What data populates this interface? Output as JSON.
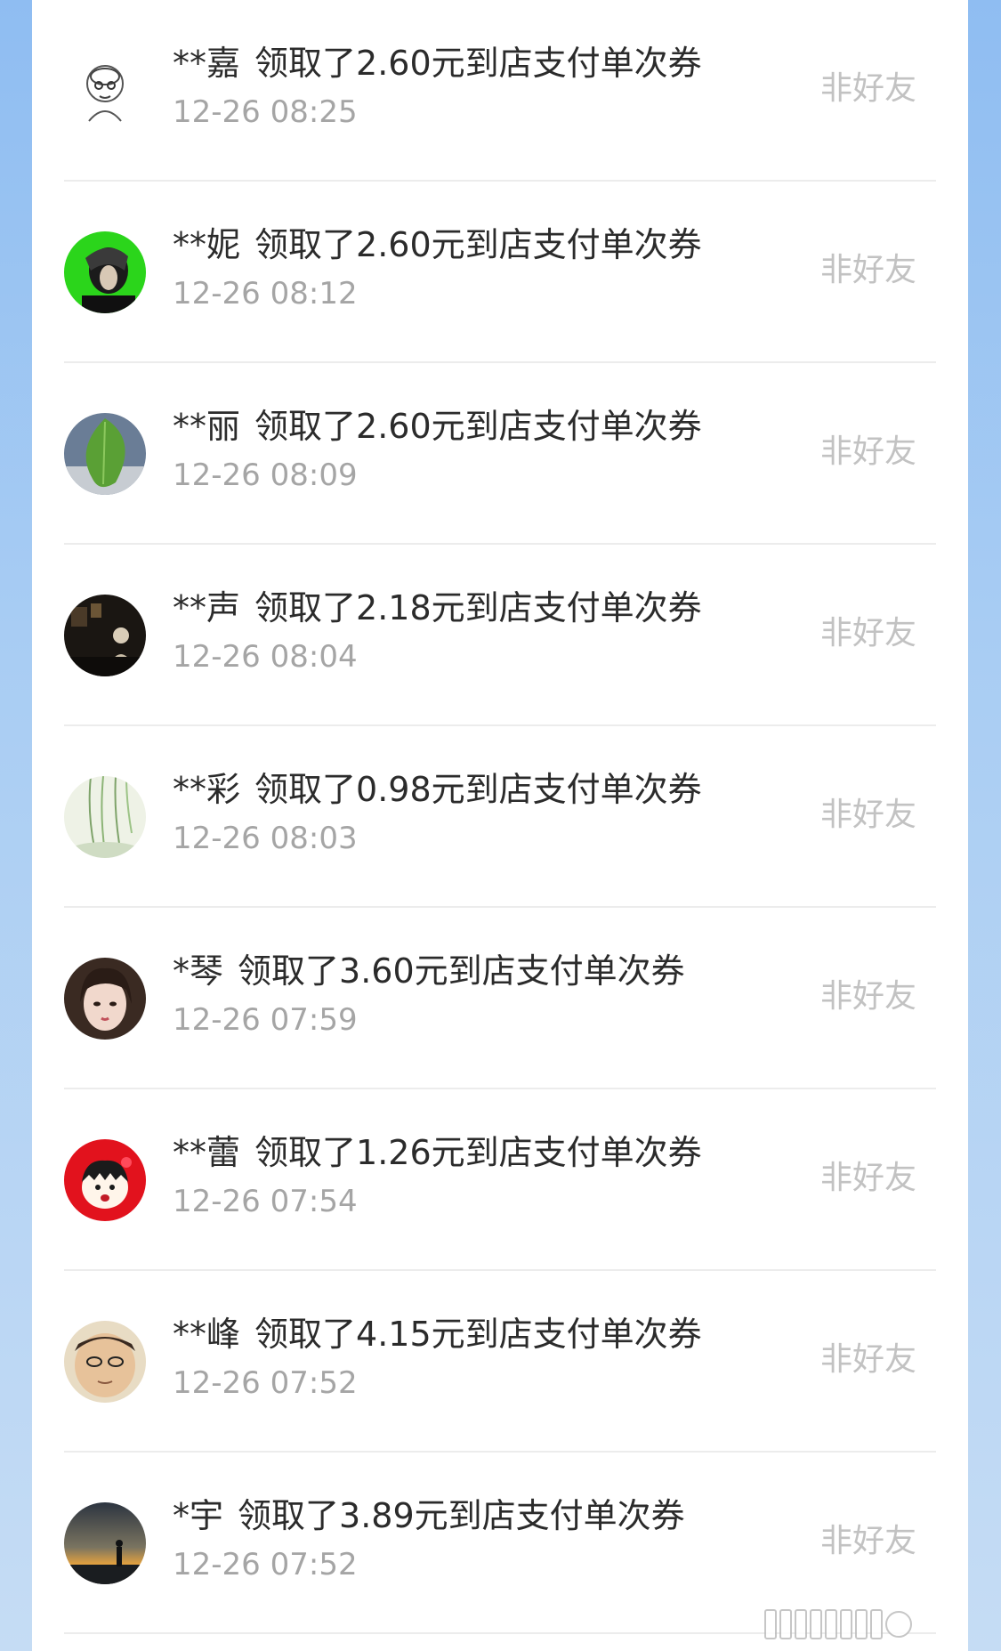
{
  "list": {
    "items": [
      {
        "name": "**嘉",
        "action": "领取了2.60元到店支付单次券",
        "time": "12-26 08:25",
        "status": "非好友",
        "avatar_icon": "sketch-person-avatar"
      },
      {
        "name": "**妮",
        "action": "领取了2.60元到店支付单次券",
        "time": "12-26 08:12",
        "status": "非好友",
        "avatar_icon": "green-portrait-avatar"
      },
      {
        "name": "**丽",
        "action": "领取了2.60元到店支付单次券",
        "time": "12-26 08:09",
        "status": "非好友",
        "avatar_icon": "leaf-avatar"
      },
      {
        "name": "**声",
        "action": "领取了2.18元到店支付单次券",
        "time": "12-26 08:04",
        "status": "非好友",
        "avatar_icon": "dark-room-avatar"
      },
      {
        "name": "**彩",
        "action": "领取了0.98元到店支付单次券",
        "time": "12-26 08:03",
        "status": "非好友",
        "avatar_icon": "willow-avatar"
      },
      {
        "name": "*琴",
        "action": "领取了3.60元到店支付单次券",
        "time": "12-26 07:59",
        "status": "非好友",
        "avatar_icon": "girl-portrait-avatar"
      },
      {
        "name": "**蕾",
        "action": "领取了1.26元到店支付单次券",
        "time": "12-26 07:54",
        "status": "非好友",
        "avatar_icon": "cartoon-girl-avatar"
      },
      {
        "name": "**峰",
        "action": "领取了4.15元到店支付单次券",
        "time": "12-26 07:52",
        "status": "非好友",
        "avatar_icon": "man-face-avatar"
      },
      {
        "name": "*宇",
        "action": "领取了3.89元到店支付单次券",
        "time": "12-26 07:52",
        "status": "非好友",
        "avatar_icon": "sunset-silhouette-avatar"
      }
    ]
  },
  "colors": {
    "background_blue": "#8fbdf2",
    "text_primary": "#2b2b2b",
    "text_secondary": "#a5a5a5",
    "status_text": "#c2c2c2"
  }
}
